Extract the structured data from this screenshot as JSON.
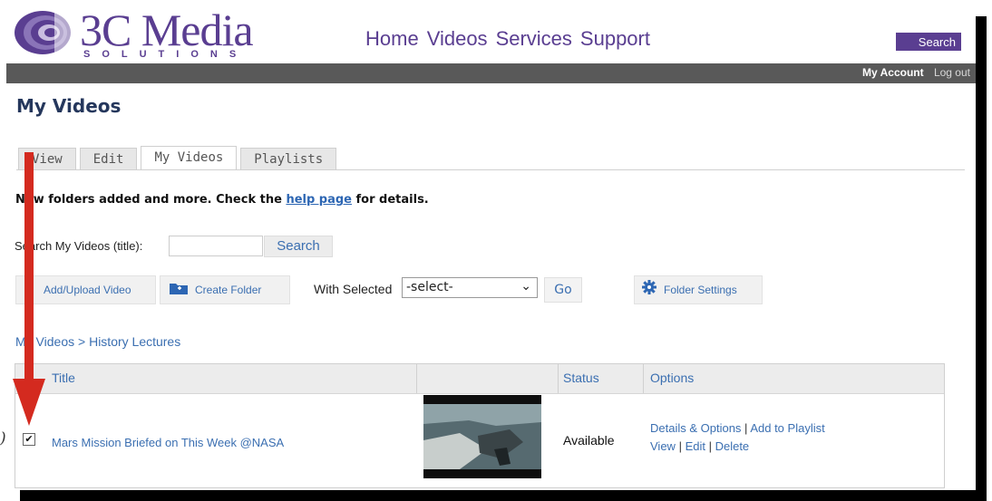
{
  "brand": {
    "name": "3C Media",
    "tagline": "SOLUTIONS"
  },
  "topnav": [
    "Home",
    "Videos",
    "Services",
    "Support"
  ],
  "header_search": {
    "value": "",
    "button": "Search"
  },
  "account": {
    "my_account": "My Account",
    "logout": "Log out"
  },
  "page_title": "My Videos",
  "tabs": [
    {
      "label": "View",
      "active": false
    },
    {
      "label": "Edit",
      "active": false
    },
    {
      "label": "My Videos",
      "active": true
    },
    {
      "label": "Playlists",
      "active": false
    }
  ],
  "notice": {
    "prefix": "New folders added and more. Check the ",
    "link": "help page",
    "suffix": " for details."
  },
  "search": {
    "label": "Search My Videos (title):",
    "value": "",
    "button": "Search"
  },
  "actions": {
    "add_upload": "Add/Upload Video",
    "create_folder": "Create Folder",
    "with_selected_label": "With Selected",
    "with_selected_value": "-select-",
    "go": "Go",
    "folder_settings": "Folder Settings"
  },
  "breadcrumb": {
    "root": "My Videos",
    "sep": " > ",
    "current": "History Lectures"
  },
  "table": {
    "headers": {
      "title": "Title",
      "thumb": "",
      "status": "Status",
      "options": "Options"
    },
    "rows": [
      {
        "checked": true,
        "title": "Mars Mission Briefed on This Week @NASA",
        "status": "Available",
        "options_line1": {
          "a": "Details & Options",
          "b": "Add to Playlist"
        },
        "options_line2": {
          "a": "View",
          "b": "Edit",
          "c": "Delete"
        }
      }
    ]
  },
  "margin_mark": ")",
  "colors": {
    "brand": "#5a3e91",
    "link": "#3b6fb1",
    "bar": "#595959",
    "arrow": "#d42a1f"
  },
  "icons": [
    "logo-swirl-icon",
    "folder-plus-icon",
    "gear-icon",
    "chevron-down-icon",
    "checkbox-icon",
    "red-arrow-annotation"
  ]
}
